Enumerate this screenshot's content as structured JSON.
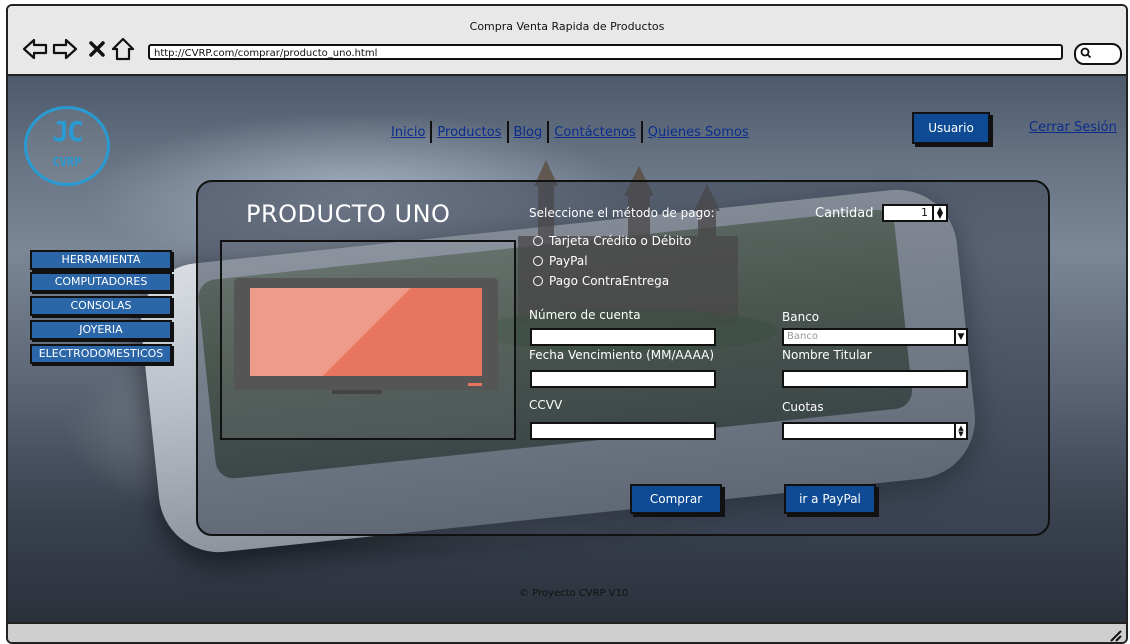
{
  "window": {
    "title": "Compra Venta Rapida de Productos",
    "url": "http://CVRP.com/comprar/producto_uno.html"
  },
  "logo": {
    "monogram": "JC",
    "name": "CVRP"
  },
  "nav": {
    "links": [
      "Inicio",
      "Productos",
      "Blog",
      "Contáctenos",
      "Quienes Somos"
    ],
    "user_button": "Usuario",
    "logout": "Cerrar Sesión"
  },
  "sidebar": {
    "categories": [
      "HERRAMIENTA",
      "COMPUTADORES",
      "CONSOLAS",
      "JOYERIA",
      "ELECTRODOMESTICOS"
    ]
  },
  "product": {
    "title": "PRODUCTO UNO"
  },
  "payment": {
    "prompt": "Seleccione el método de pago:",
    "options": [
      "Tarjeta Crédito o Débito",
      "PayPal",
      "Pago ContraEntrega"
    ],
    "quantity_label": "Cantidad",
    "quantity_value": "1",
    "account_label": "Número de cuenta",
    "bank_label": "Banco",
    "bank_placeholder": "Banco",
    "expiry_label": "Fecha Vencimiento (MM/AAAA)",
    "holder_label": "Nombre Titular",
    "cvv_label": "CCVV",
    "installments_label": "Cuotas",
    "buy_button": "Comprar",
    "paypal_button": "ir a PayPal"
  },
  "footer": {
    "copyright": "© Proyecto CVRP V10"
  },
  "colors": {
    "primary_button": "#0e4b94",
    "link": "#0a2d8c",
    "logo": "#2a9ad3",
    "product_screen": "#e87560"
  }
}
